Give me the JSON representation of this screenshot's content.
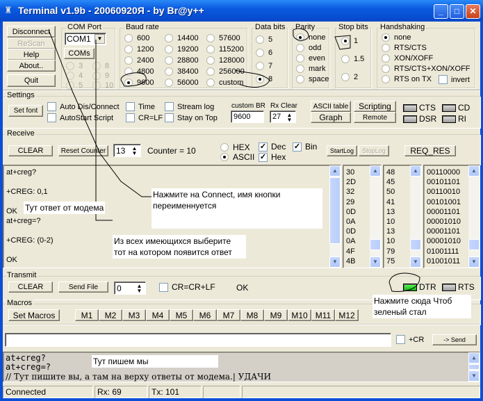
{
  "window": {
    "title": "Terminal v1.9b - 20060920Я - by Br@y++",
    "icon": "terminal-app-icon",
    "controls": {
      "minimize": "_",
      "maximize": "□",
      "close": "✕"
    }
  },
  "top_buttons": {
    "disconnect": "Disconnect",
    "rescan": "ReScan",
    "help": "Help",
    "about": "About..",
    "quit": "Quit"
  },
  "com_port": {
    "title": "COM Port",
    "selected": "COM1",
    "coms_button": "COMs",
    "ports": [
      "3",
      "4",
      "5",
      "8",
      "9",
      "10"
    ]
  },
  "baud_rate": {
    "title": "Baud rate",
    "options": [
      "600",
      "1200",
      "2400",
      "4800",
      "9600",
      "14400",
      "19200",
      "28800",
      "38400",
      "56000",
      "57600",
      "115200",
      "128000",
      "256000",
      "custom"
    ],
    "selected": "9600"
  },
  "data_bits": {
    "title": "Data bits",
    "options": [
      "5",
      "6",
      "7",
      "8"
    ],
    "selected": "8"
  },
  "parity": {
    "title": "Parity",
    "options": [
      "none",
      "odd",
      "even",
      "mark",
      "space"
    ],
    "selected": "none"
  },
  "stop_bits": {
    "title": "Stop bits",
    "options": [
      "1",
      "1.5",
      "2"
    ],
    "selected": "1"
  },
  "handshaking": {
    "title": "Handshaking",
    "options": [
      "none",
      "RTS/CTS",
      "XON/XOFF",
      "RTS/CTS+XON/XOFF",
      "RTS on TX"
    ],
    "selected": "none",
    "invert_label": "invert",
    "invert_checked": false
  },
  "settings": {
    "title": "Settings",
    "set_font": "Set font",
    "checks": {
      "auto_dis_connect": {
        "label": "Auto Dis/Connect",
        "checked": false
      },
      "autostart_script": {
        "label": "AutoStart Script",
        "checked": false
      },
      "time": {
        "label": "Time",
        "checked": false
      },
      "cr_lf": {
        "label": "CR=LF",
        "checked": false
      },
      "stream_log": {
        "label": "Stream log",
        "checked": false
      },
      "stay_on_top": {
        "label": "Stay on Top",
        "checked": false
      }
    },
    "custom_br_label": "custom BR",
    "custom_br_value": "9600",
    "rx_clear_label": "Rx Clear",
    "rx_clear_value": "27",
    "ascii_table": "ASCII table",
    "graph": "Graph",
    "scripting": "Scripting",
    "remote": "Remote",
    "leds": {
      "cts": "CTS",
      "cd": "CD",
      "dsr": "DSR",
      "ri": "RI"
    }
  },
  "receive": {
    "title": "Receive",
    "clear": "CLEAR",
    "reset_counter": "Reset Counter",
    "counter_spin": "13",
    "counter_text": "Counter = 10",
    "hex_label": "HEX",
    "ascii_label": "ASCII",
    "mode_selected": "ASCII",
    "dec_label": "Dec",
    "hex_check_label": "Hex",
    "bin_label": "Bin",
    "dec_checked": true,
    "hex_checked": true,
    "bin_checked": true,
    "start_log": "StartLog",
    "stop_log": "StopLog",
    "req_res": "REQ_RES",
    "lines": [
      "at+creg?",
      "",
      "+CREG: 0,1",
      "",
      "OK",
      "at+creg=?",
      "",
      "+CREG: (0-2)",
      "",
      "OK"
    ],
    "hex_col": [
      "30",
      "2D",
      "32",
      "29",
      "0D",
      "0A",
      "0D",
      "0A",
      "4F",
      "4B"
    ],
    "dec_col": [
      "48",
      "45",
      "50",
      "41",
      "13",
      "10",
      "13",
      "10",
      "79",
      "75"
    ],
    "bin_col": [
      "00110000",
      "00101101",
      "00110010",
      "00101001",
      "00001101",
      "00001010",
      "00001101",
      "00001010",
      "01001111",
      "01001011"
    ]
  },
  "transmit": {
    "title": "Transmit",
    "clear": "CLEAR",
    "send_file": "Send File",
    "spin_value": "0",
    "cr_crlf_label": "CR=CR+LF",
    "cr_crlf_checked": false,
    "status": "OK",
    "dtr": "DTR",
    "rts": "RTS",
    "dtr_on": true,
    "rts_on": false
  },
  "macros": {
    "title": "Macros",
    "set_macros": "Set Macros",
    "buttons": [
      "M1",
      "M2",
      "M3",
      "M4",
      "M5",
      "M6",
      "M7",
      "M8",
      "M9",
      "M10",
      "M11",
      "M12"
    ]
  },
  "send_bar": {
    "input_value": "",
    "plus_cr_label": "+CR",
    "plus_cr_checked": false,
    "send": "-> Send"
  },
  "transmit_log": {
    "lines": [
      "at+creg?",
      "at+creg=?",
      "// Тут пишите вы, а там на верху ответы от модема.| УДАЧИ"
    ]
  },
  "status_bar": {
    "connection": "Connected",
    "rx": "Rx: 69",
    "tx": "Tx: 101"
  },
  "annotations": {
    "modem_reply": "Тут ответ от модема",
    "press_connect": "Нажмите на Connect, имя кнопки переименнуется",
    "choose_port": "Из всех имеющихся выберите тот на котором появится ответ",
    "press_here": "Нажмите сюда Чтоб зеленый стал",
    "we_write": "Тут пишем мы"
  }
}
